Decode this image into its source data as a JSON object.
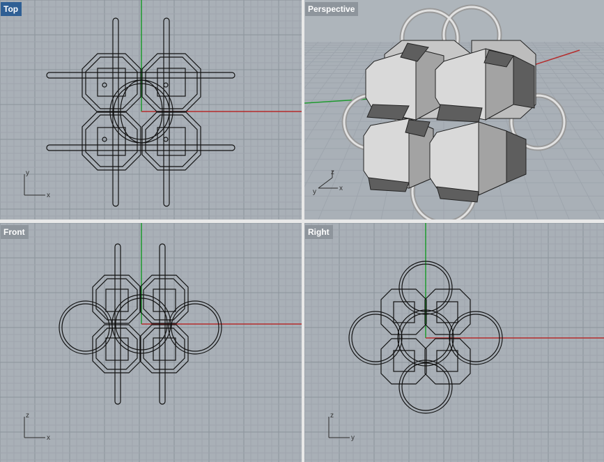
{
  "viewports": {
    "top": {
      "label": "Top",
      "active": true,
      "axis1": "x",
      "axis2": "y"
    },
    "perspective": {
      "label": "Perspective",
      "active": false,
      "axis1": "x",
      "axis2": "y",
      "axis3": "z"
    },
    "front": {
      "label": "Front",
      "active": false,
      "axis1": "x",
      "axis2": "z"
    },
    "right": {
      "label": "Right",
      "active": false,
      "axis1": "y",
      "axis2": "z"
    }
  },
  "colors": {
    "viewport_bg": "#a9b0b7",
    "grid_minor": "#9ea5ad",
    "grid_major": "#8c939b",
    "x_axis": "#b52b2b",
    "y_axis": "#1e9a2e",
    "wire": "#111111",
    "active_label": "#2f5f94",
    "inactive_label": "#8e959c",
    "shade_light": "#dadada",
    "shade_dark": "#5b5b5b"
  }
}
